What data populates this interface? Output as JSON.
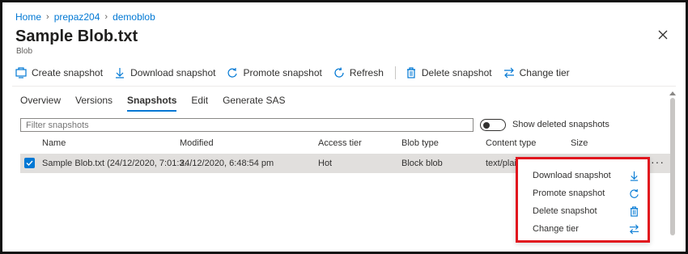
{
  "breadcrumb": {
    "items": [
      "Home",
      "prepaz204",
      "demoblob"
    ]
  },
  "header": {
    "title": "Sample Blob.txt",
    "subtitle": "Blob"
  },
  "toolbar": {
    "create_snapshot": "Create snapshot",
    "download_snapshot": "Download snapshot",
    "promote_snapshot": "Promote snapshot",
    "refresh": "Refresh",
    "delete_snapshot": "Delete snapshot",
    "change_tier": "Change tier"
  },
  "tabs": [
    {
      "label": "Overview",
      "active": false
    },
    {
      "label": "Versions",
      "active": false
    },
    {
      "label": "Snapshots",
      "active": true
    },
    {
      "label": "Edit",
      "active": false
    },
    {
      "label": "Generate SAS",
      "active": false
    }
  ],
  "filter": {
    "placeholder": "Filter snapshots",
    "value": ""
  },
  "show_deleted": {
    "label": "Show deleted snapshots",
    "on": false
  },
  "table": {
    "columns": [
      "Name",
      "Modified",
      "Access tier",
      "Blob type",
      "Content type",
      "Size"
    ],
    "rows": [
      {
        "name": "Sample Blob.txt (24/12/2020, 7:01:3...",
        "modified": "24/12/2020, 6:48:54 pm",
        "access_tier": "Hot",
        "blob_type": "Block blob",
        "content_type": "text/plain",
        "size": "",
        "selected": true
      }
    ]
  },
  "context_menu": {
    "items": [
      {
        "label": "Download snapshot",
        "icon": "download-icon"
      },
      {
        "label": "Promote snapshot",
        "icon": "promote-icon"
      },
      {
        "label": "Delete snapshot",
        "icon": "trash-icon"
      },
      {
        "label": "Change tier",
        "icon": "swap-icon"
      }
    ]
  },
  "colors": {
    "accent": "#0078d4",
    "highlight_box": "#e1161e",
    "row_selected": "#e1dfdd"
  }
}
